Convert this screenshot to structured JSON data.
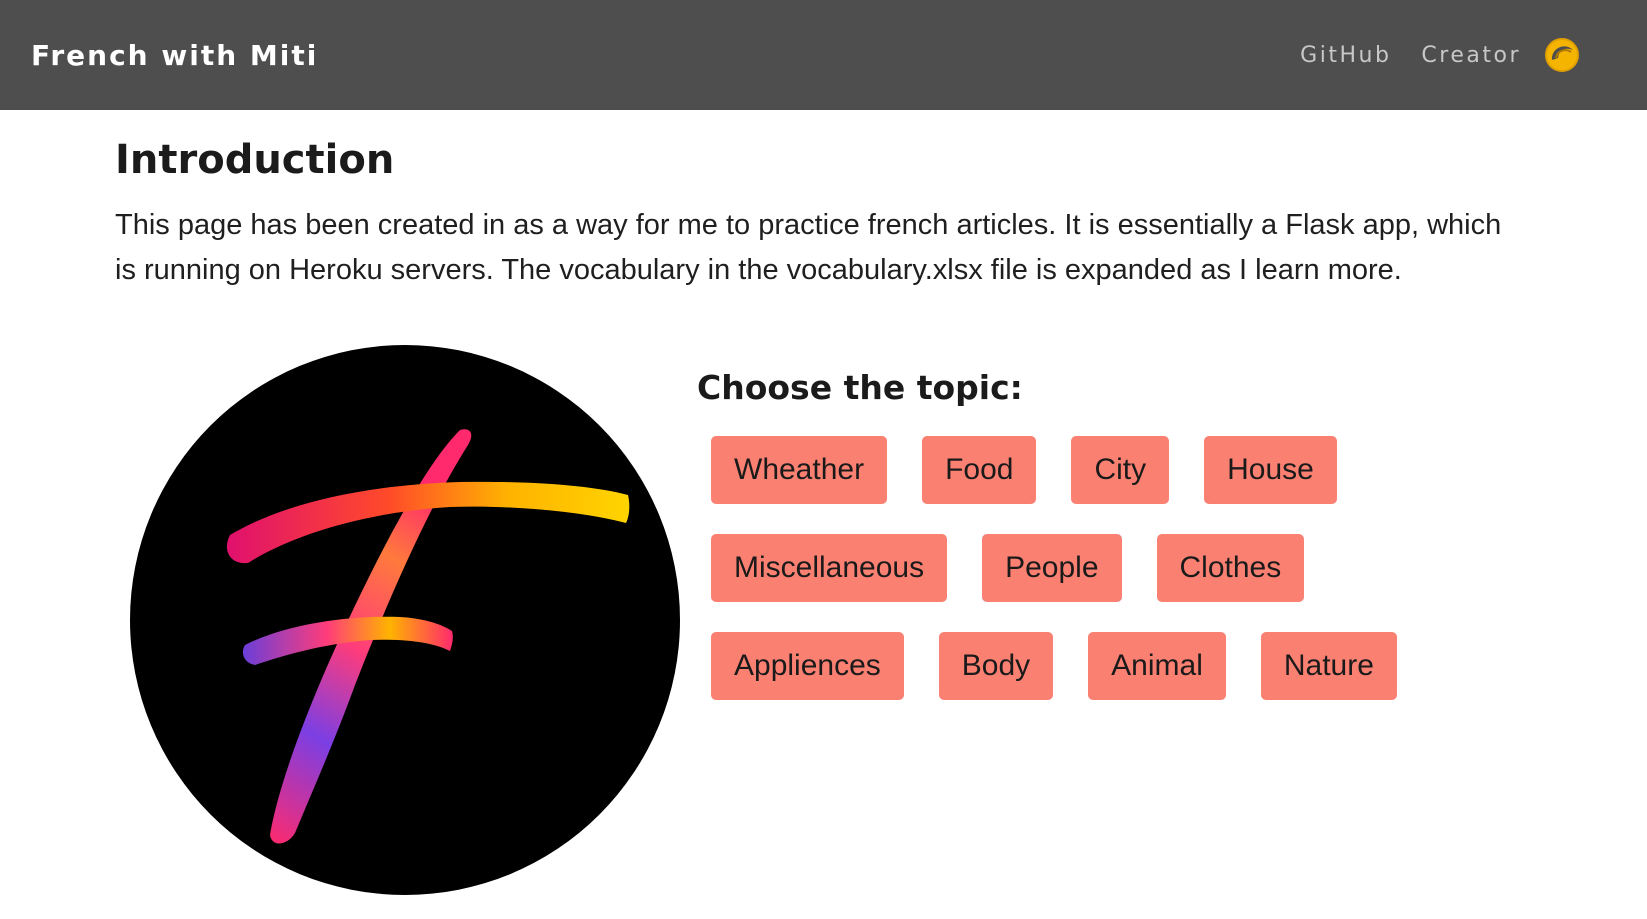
{
  "navbar": {
    "brand": "French with Miti",
    "links": [
      {
        "label": "GitHub"
      },
      {
        "label": "Creator"
      }
    ],
    "icon": "croissant-icon",
    "icon_color": "#f5b400"
  },
  "main": {
    "title": "Introduction",
    "intro": "This page has been created in as a way for me to practice french articles. It is essentially a Flask app, which is running on Heroku servers. The vocabulary in the vocabulary.xlsx file is expanded as I learn more.",
    "logo": {
      "icon": "letter-f-logo",
      "background": "#000000"
    },
    "topics_heading": "Choose the topic:",
    "topic_rows": [
      [
        "Wheather",
        "Food",
        "City",
        "House"
      ],
      [
        "Miscellaneous",
        "People",
        "Clothes"
      ],
      [
        "Appliences",
        "Body",
        "Animal",
        "Nature"
      ]
    ],
    "button_color": "#fa8072"
  }
}
